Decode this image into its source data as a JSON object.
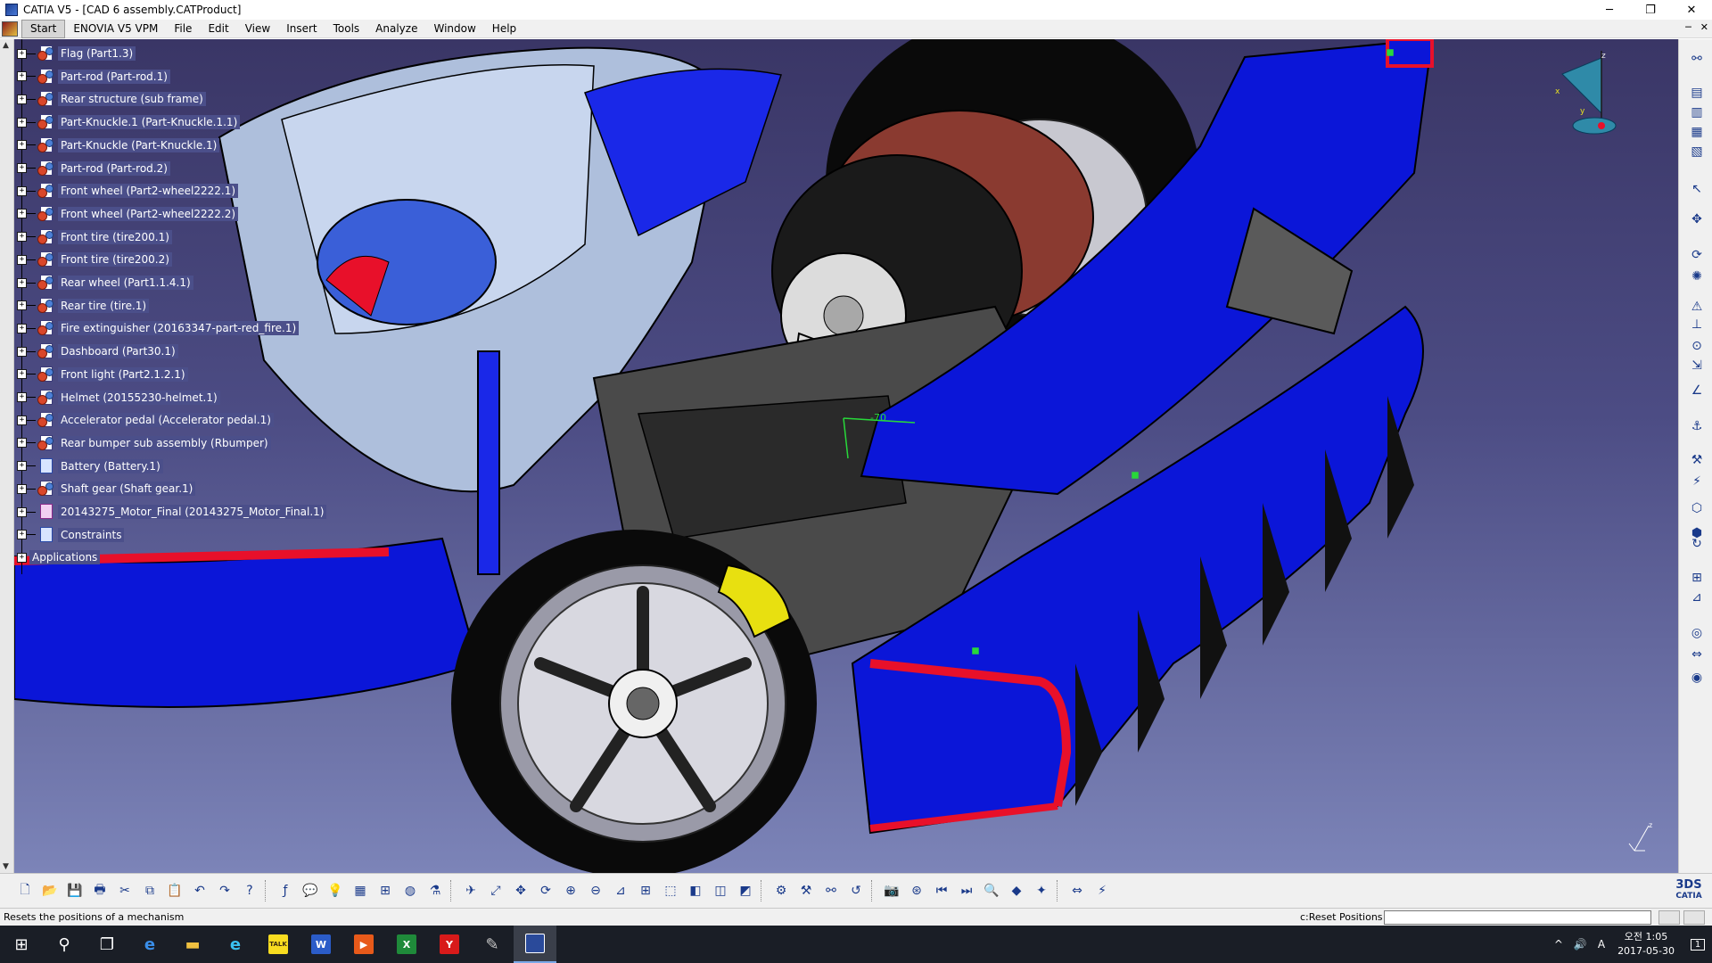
{
  "window": {
    "title": "CATIA V5 - [CAD 6 assembly.CATProduct]",
    "minimize_glyph": "─",
    "maximize_glyph": "❐",
    "close_glyph": "✕"
  },
  "menu": {
    "items": [
      "Start",
      "ENOVIA V5 VPM",
      "File",
      "Edit",
      "View",
      "Insert",
      "Tools",
      "Analyze",
      "Window",
      "Help"
    ],
    "mdi_minimize": "─",
    "mdi_close": "✕"
  },
  "spec_tree": {
    "items": [
      {
        "label": "Flag (Part1.3)",
        "icon": "part-icon"
      },
      {
        "label": "Part-rod (Part-rod.1)",
        "icon": "part-icon"
      },
      {
        "label": "Rear structure (sub frame)",
        "icon": "part-icon"
      },
      {
        "label": "Part-Knuckle.1 (Part-Knuckle.1.1)",
        "icon": "part-icon"
      },
      {
        "label": "Part-Knuckle (Part-Knuckle.1)",
        "icon": "part-icon"
      },
      {
        "label": "Part-rod (Part-rod.2)",
        "icon": "part-icon"
      },
      {
        "label": "Front wheel  (Part2-wheel2222.1)",
        "icon": "part-icon"
      },
      {
        "label": "Front wheel  (Part2-wheel2222.2)",
        "icon": "part-icon"
      },
      {
        "label": "Front tire (tire200.1)",
        "icon": "part-icon"
      },
      {
        "label": "Front tire (tire200.2)",
        "icon": "part-icon"
      },
      {
        "label": "Rear wheel (Part1.1.4.1)",
        "icon": "part-icon"
      },
      {
        "label": "Rear tire  (tire.1)",
        "icon": "part-icon"
      },
      {
        "label": "Fire extinguisher (20163347-part-red_fire.1)",
        "icon": "part-icon"
      },
      {
        "label": "Dashboard (Part30.1)",
        "icon": "part-icon"
      },
      {
        "label": "Front light (Part2.1.2.1)",
        "icon": "part-icon"
      },
      {
        "label": "Helmet (20155230-helmet.1)",
        "icon": "part-icon"
      },
      {
        "label": "Accelerator pedal (Accelerator pedal.1)",
        "icon": "part-icon"
      },
      {
        "label": "Rear bumper sub assembly (Rbumper)",
        "icon": "part-icon"
      },
      {
        "label": "Battery (Battery.1)",
        "icon": "constraints"
      },
      {
        "label": "Shaft gear (Shaft gear.1)",
        "icon": "part-icon"
      },
      {
        "label": "20143275_Motor_Final (20143275_Motor_Final.1)",
        "icon": "motor"
      },
      {
        "label": "Constraints",
        "icon": "constraints"
      },
      {
        "label": "Applications",
        "icon": "none"
      }
    ],
    "expander_glyph": "+"
  },
  "viewport": {
    "dimension_label": "-70",
    "compass_x": "x",
    "compass_y": "y",
    "compass_z": "z",
    "mini_axis_z": "z"
  },
  "statusbar": {
    "message": "Resets the positions of a mechanism",
    "command_label": "c:Reset Positions",
    "command_value": ""
  },
  "branding": {
    "ds": "3DS",
    "name": "CATIA"
  },
  "taskbar": {
    "tray_chevron": "^",
    "tray_volume": "🔊",
    "tray_ime": "A",
    "clock_time": "오전 1:05",
    "clock_date": "2017-05-30",
    "notif_count": "1",
    "taskbar_tiles": [
      "TALK",
      "W",
      "▶",
      "X",
      "Y"
    ]
  },
  "colors": {
    "tree_label_bg": "#4b4f8a",
    "viewport_top": "#3a3666",
    "viewport_bottom": "#7c84b8",
    "car_blue": "#0b16d8",
    "car_red": "#e8102a"
  }
}
